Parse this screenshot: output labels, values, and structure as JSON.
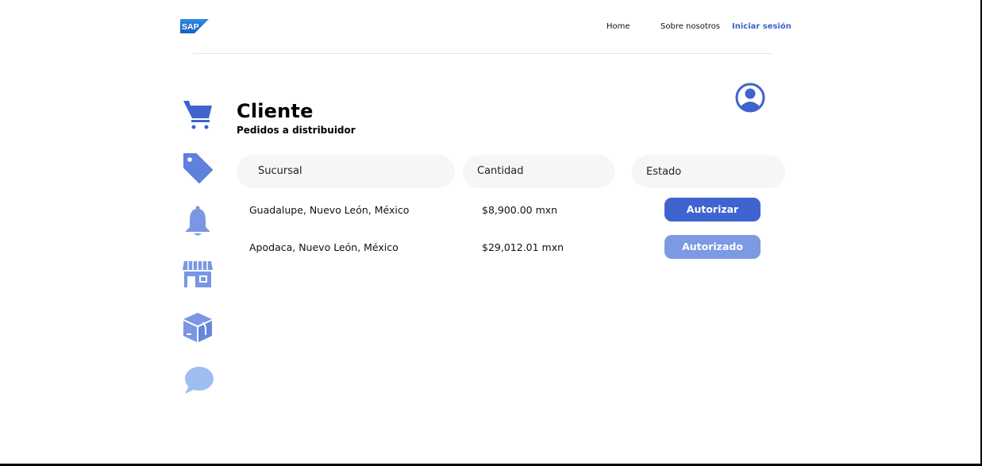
{
  "brand": {
    "logo_text": "SAP"
  },
  "nav": {
    "home": "Home",
    "about": "Sobre nosotros",
    "login": "Iniciar sesión"
  },
  "page": {
    "title": "Cliente",
    "subtitle": "Pedidos a distribuidor"
  },
  "sidebar": {
    "items": [
      {
        "icon": "cart-icon",
        "color": "#3f63cf"
      },
      {
        "icon": "tag-icon",
        "color": "#5f80dd"
      },
      {
        "icon": "bell-icon",
        "color": "#7a96e4"
      },
      {
        "icon": "store-icon",
        "color": "#7a96e4"
      },
      {
        "icon": "box-icon",
        "color": "#7a96e4"
      },
      {
        "icon": "chat-icon",
        "color": "#9ebdf0"
      }
    ]
  },
  "table": {
    "headers": [
      "Sucursal",
      "Cantidad",
      "Estado"
    ],
    "rows": [
      {
        "sucursal": "Guadalupe, Nuevo León, México",
        "cantidad": "$8,900.00 mxn",
        "estado": "Autorizar"
      },
      {
        "sucursal": "Apodaca, Nuevo León, México",
        "cantidad": "$29,012.01 mxn",
        "estado": "Autorizado"
      }
    ]
  },
  "colors": {
    "accent": "#3f63cf",
    "accent_light": "#7c99e3",
    "pill_bg": "#f6f6f6"
  }
}
